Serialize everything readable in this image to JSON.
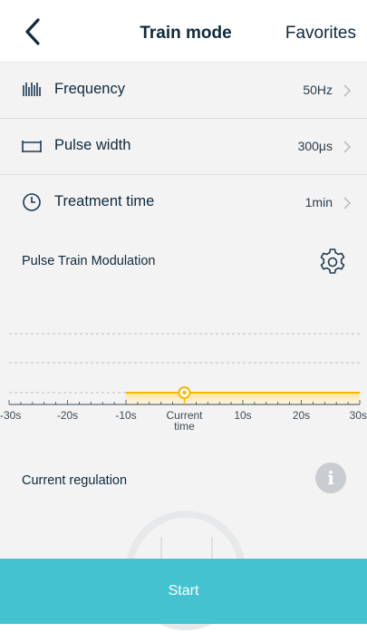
{
  "header": {
    "title": "Train mode",
    "favorites_label": "Favorites"
  },
  "settings": [
    {
      "icon": "frequency-icon",
      "label": "Frequency",
      "value": "50Hz"
    },
    {
      "icon": "pulse-width-icon",
      "label": "Pulse width",
      "value": "300μs"
    },
    {
      "icon": "clock-icon",
      "label": "Treatment time",
      "value": "1min"
    }
  ],
  "modulation": {
    "title": "Pulse Train Modulation",
    "chart_data": {
      "type": "area",
      "x_ticks": [
        "-30s",
        "-20s",
        "-10s",
        "Current time",
        "10s",
        "20s",
        "30s"
      ],
      "current_marker_label": [
        "Current",
        "time"
      ],
      "xlim": [
        -30,
        30
      ],
      "series": [
        {
          "x": [
            -10,
            30
          ],
          "y": [
            1,
            1
          ]
        }
      ],
      "marker_x": 0,
      "accent_color": "#f5b800",
      "grid": true
    }
  },
  "regulation": {
    "title": "Current regulation"
  },
  "start_label": "Start"
}
